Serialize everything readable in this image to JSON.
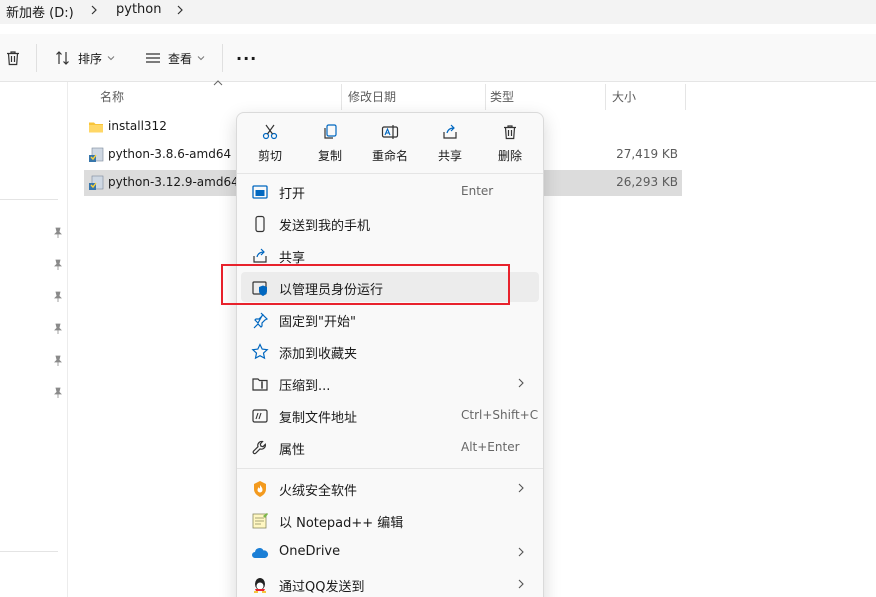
{
  "breadcrumb": {
    "drive": "新加卷 (D:)",
    "folder": "python"
  },
  "toolbar": {
    "sort_label": "排序",
    "view_label": "查看",
    "more": "···"
  },
  "columns": {
    "name": "名称",
    "modified": "修改日期",
    "type": "类型",
    "size": "大小"
  },
  "files": [
    {
      "name": "install312",
      "size": "",
      "icon": "folder-icon"
    },
    {
      "name": "python-3.8.6-amd64",
      "size": "27,419 KB",
      "icon": "installer-icon"
    },
    {
      "name": "python-3.12.9-amd64",
      "size": "26,293 KB",
      "icon": "installer-icon"
    }
  ],
  "context_menu": {
    "quick_actions": [
      {
        "label": "剪切",
        "icon": "cut-icon"
      },
      {
        "label": "复制",
        "icon": "copy-icon"
      },
      {
        "label": "重命名",
        "icon": "rename-icon"
      },
      {
        "label": "共享",
        "icon": "share-icon"
      },
      {
        "label": "删除",
        "icon": "delete-icon"
      }
    ],
    "items": [
      {
        "label": "打开",
        "shortcut": "Enter",
        "icon": "open-app-icon"
      },
      {
        "label": "发送到我的手机",
        "icon": "phone-icon"
      },
      {
        "label": "共享",
        "icon": "share-icon"
      },
      {
        "label": "以管理员身份运行",
        "icon": "admin-shield-icon",
        "highlighted": true
      },
      {
        "label": "固定到\"开始\"",
        "icon": "pin-icon"
      },
      {
        "label": "添加到收藏夹",
        "icon": "star-icon"
      },
      {
        "label": "压缩到...",
        "icon": "zip-icon",
        "submenu": true
      },
      {
        "label": "复制文件地址",
        "shortcut": "Ctrl+Shift+C",
        "icon": "copy-path-icon"
      },
      {
        "label": "属性",
        "shortcut": "Alt+Enter",
        "icon": "wrench-icon"
      },
      {
        "label": "火绒安全软件",
        "icon": "huorong-icon",
        "submenu": true
      },
      {
        "label": "以 Notepad++ 编辑",
        "icon": "notepad-plus-plus-icon"
      },
      {
        "label": "OneDrive",
        "icon": "onedrive-icon",
        "submenu": true
      },
      {
        "label": "通过QQ发送到",
        "icon": "qq-icon",
        "submenu": true
      }
    ]
  },
  "colors": {
    "selection": "#dcdcdc",
    "menu_bg": "#f9f9f9",
    "highlight_box": "#e8222c",
    "accent_blue": "#0067c0"
  }
}
